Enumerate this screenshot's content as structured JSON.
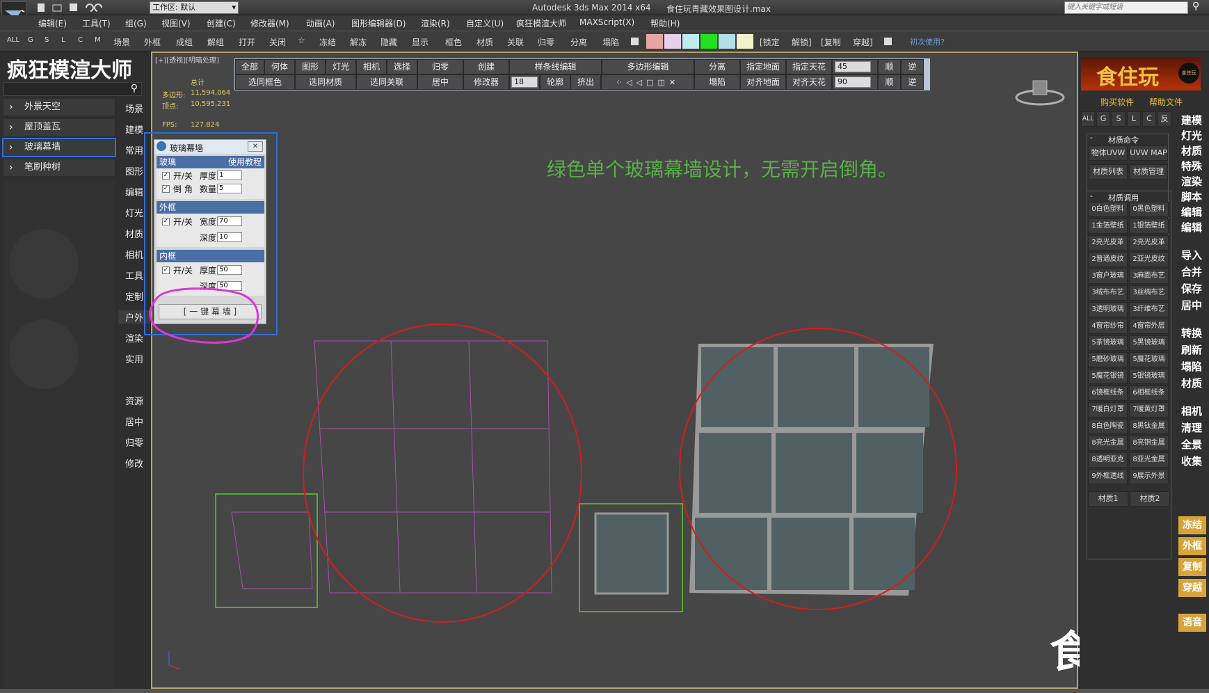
{
  "titlebar": {
    "workspace_label": "工作区: 默认",
    "title": "Autodesk 3ds Max  2014 x64",
    "filename": "食住玩青藏效果图设计.max",
    "search_placeholder": "键入关键字或短语"
  },
  "menubar": {
    "items": [
      "编辑(E)",
      "工具(T)",
      "组(G)",
      "视图(V)",
      "创建(C)",
      "修改器(M)",
      "动画(A)",
      "图形编辑器(D)",
      "渲染(R)",
      "自定义(U)",
      "疯狂模渲大师",
      "MAXScript(X)",
      "帮助(H)"
    ]
  },
  "toolbar2": {
    "filters": [
      "ALL",
      "G",
      "S",
      "L",
      "C",
      "M"
    ],
    "items": [
      "场景",
      "外框",
      "成组",
      "解组",
      "打开",
      "关闭",
      "☆",
      "冻结",
      "解冻",
      "隐藏",
      "显示",
      "框色",
      "材质",
      "关联",
      "归零",
      "分离",
      "塌陷"
    ],
    "swatches": [
      "#e7a4a4",
      "#e4d2ec",
      "#bfecef",
      "#22e022",
      "#b3e0e8",
      "#f2f2c8"
    ],
    "right_items": [
      "[锁定",
      "解锁]",
      "[复制",
      "穿越]"
    ],
    "first_use": "初次使用?"
  },
  "left_panel": {
    "brand": "疯狂模渲大师",
    "sections": [
      "外景天空",
      "屋顶盖瓦",
      "玻璃幕墙",
      "笔刷种树"
    ],
    "selected": "玻璃幕墙",
    "categories": [
      "场景",
      "建模",
      "常用",
      "图形",
      "编辑",
      "灯光",
      "材质",
      "相机",
      "工具",
      "定制",
      "户外",
      "渲染",
      "实用",
      "资源",
      "居中",
      "归零",
      "修改"
    ]
  },
  "viewport": {
    "label": "[+][透视][明暗处理]",
    "stats_total": "总计",
    "stats_poly_label": "多边形:",
    "stats_poly": "11,594,064",
    "stats_vert_label": "顶点:",
    "stats_vert": "10,595,231",
    "fps_label": "FPS:",
    "fps": "127.824",
    "annotation": "绿色单个玻璃幕墙设计，无需开启倒角。",
    "toolbar_row1": [
      "全部",
      "何体",
      "图形",
      "灯光",
      "相机",
      "选择",
      "归零",
      "创建",
      "样条线编辑",
      "多边形编辑",
      "分离",
      "指定地面",
      "指定天花"
    ],
    "toolbar_row2": [
      "选同框色",
      "选同材质",
      "选同关联",
      "居中",
      "修改器",
      "轮廓",
      "挤出",
      "塌陷",
      "对齐地面",
      "对齐天花"
    ],
    "spin_a": "45",
    "spin_b": "90",
    "spin_c": "18",
    "dir1": "顺",
    "dir2": "逆"
  },
  "dialog": {
    "title": "玻璃幕墙",
    "glass_header": "玻璃",
    "tutorial": "使用教程",
    "onoff": "开/关",
    "thickness_label": "厚度",
    "thickness": "1",
    "bevel_label": "倒 角",
    "count_label": "数量",
    "count": "5",
    "outer_header": "外框",
    "width_label": "宽度",
    "outer_width": "70",
    "depth_label": "深度",
    "outer_depth": "10",
    "inner_header": "内框",
    "inner_thickness": "50",
    "inner_depth": "50",
    "button": "[ 一 键 幕 墙 ]"
  },
  "right_panel": {
    "logo": "食住玩",
    "logo_sub": "食住玩",
    "buy": "购买软件",
    "help": "帮助文件",
    "filters": [
      "ALL",
      "G",
      "S",
      "L",
      "C",
      "反"
    ],
    "material_cmd_title": "材质命令",
    "material_cmd": [
      "物体UVW",
      "UVW MAP",
      "材质列表",
      "材质管理"
    ],
    "material_call_title": "材质调用",
    "materials": [
      "0白色塑料",
      "0黑色塑料",
      "1金箔壁纸",
      "1银箔壁纸",
      "2亮光皮革",
      "2亮光皮革",
      "2普通皮纹",
      "2亚光皮纹",
      "3窗户玻璃",
      "3麻面布艺",
      "3绒布布艺",
      "3丝绸布艺",
      "3透明玻璃",
      "3纤维布艺",
      "4窗帘纱帘",
      "4窗帘外层",
      "5茶镜玻璃",
      "5黑镜玻璃",
      "5磨砂玻璃",
      "5魔花玻璃",
      "5魔花银镜",
      "5银镜玻璃",
      "6镜框线条",
      "6相框线条",
      "7暖白灯罩",
      "7暖黄灯罩",
      "8白色陶瓷",
      "8黑钛金属",
      "8亮光金属",
      "8亮铜金属",
      "8透明亚克",
      "8亚光金属",
      "9外框透线",
      "9展示外景"
    ],
    "material_tabs": [
      "材质1",
      "材质2"
    ],
    "commands_a": [
      "建模",
      "灯光",
      "材质",
      "特殊",
      "渲染",
      "脚本",
      "编辑",
      "编辑"
    ],
    "commands_b": [
      "导入",
      "合并",
      "保存",
      "居中"
    ],
    "commands_c": [
      "转换",
      "刷新",
      "塌陷",
      "材质"
    ],
    "commands_d": [
      "相机",
      "清理",
      "全景",
      "收集"
    ],
    "yellow": [
      "冻结",
      "外框",
      "复制",
      "穿越",
      "语音"
    ]
  },
  "watermark": "食住玩"
}
